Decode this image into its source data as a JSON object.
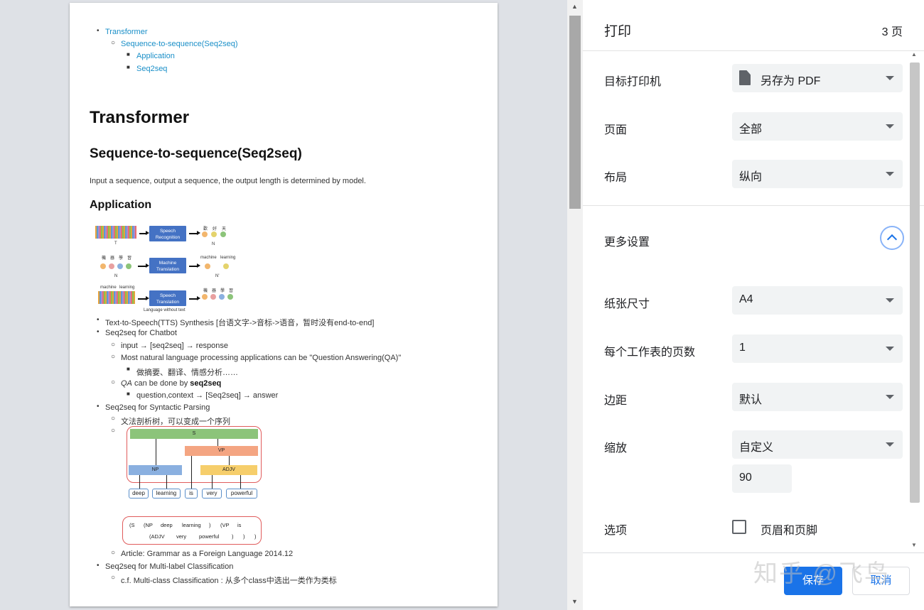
{
  "preview": {
    "toc": [
      "Transformer",
      "Sequence-to-sequence(Seq2seq)",
      "Application",
      "Seq2seq"
    ],
    "h1": "Transformer",
    "h2": "Sequence-to-sequence(Seq2seq)",
    "intro": "Input a sequence, output a sequence, the output length is determined by model.",
    "h3": "Application",
    "figure": {
      "box1": "Speech Recognition",
      "box2": "Machine Translation",
      "box3": "Speech Translation",
      "t_label": "T",
      "n_label": "N",
      "n_prime_label": "N'",
      "out1": [
        "歡",
        "好",
        "天"
      ],
      "in2": [
        "機",
        "器",
        "學",
        "習"
      ],
      "out2": [
        "machine",
        "learning"
      ],
      "in3": [
        "machine",
        "learning"
      ],
      "out3": [
        "機",
        "器",
        "學",
        "習"
      ],
      "caption": "Language without text",
      "colors": [
        "#f2b66d",
        "#e4d36c",
        "#8ab0e0",
        "#8cc47a"
      ]
    },
    "bullets": {
      "tts": "Text-to-Speech(TTS) Synthesis [台语文字->音标->语音，暂时没有end-to-end]",
      "chatbot": "Seq2seq for Chatbot",
      "chatbot_io": "input → [seq2seq] → response",
      "nlp_qa": "Most natural language processing applications can be \"Question Answering(QA)\"",
      "nlp_examples": "做摘要、翻译、情感分析……",
      "qa_prefix": "QA",
      "qa_mid": " can be done by ",
      "qa_bold": "seq2seq",
      "qa_io": "question,context → [Seq2seq] → answer",
      "syntax": "Seq2seq for Syntactic Parsing",
      "syntax_tree": "文法剖析树，可以变成一个序列",
      "article": "Article: Grammar as a Foreign Language 2014.12",
      "multilabel": "Seq2seq for Multi-label Classification",
      "multiclass": "c.f. Multi-class Classification : 从多个class中选出一类作为类标"
    },
    "tree": {
      "s": "S",
      "vp": "VP",
      "np": "NP",
      "adjv": "ADJV",
      "words": [
        "deep",
        "learning",
        "is",
        "very",
        "powerful"
      ],
      "seq_line1": [
        "(S",
        "(NP",
        "deep",
        "learning",
        ")",
        "(VP",
        "is"
      ],
      "seq_line2": [
        "(ADJV",
        "very",
        "powerful",
        ")",
        ")",
        ")"
      ]
    }
  },
  "panel": {
    "title": "打印",
    "page_count": "3 页",
    "destination_label": "目标打印机",
    "destination_value": "另存为 PDF",
    "pages_label": "页面",
    "pages_value": "全部",
    "layout_label": "布局",
    "layout_value": "纵向",
    "more_settings": "更多设置",
    "paper_label": "纸张尺寸",
    "paper_value": "A4",
    "per_sheet_label": "每个工作表的页数",
    "per_sheet_value": "1",
    "margins_label": "边距",
    "margins_value": "默认",
    "scale_label": "缩放",
    "scale_value": "自定义",
    "scale_number": "90",
    "options_label": "选项",
    "headers_footers": "页眉和页脚",
    "save": "保存",
    "cancel": "取消",
    "watermark": "知乎 @飞鸟"
  }
}
